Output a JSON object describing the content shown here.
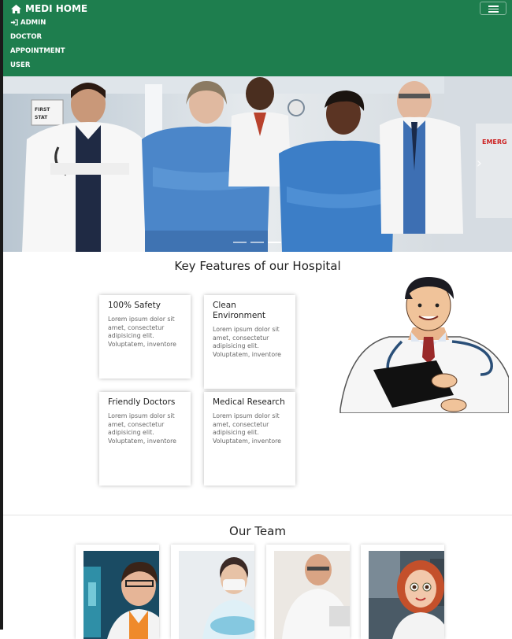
{
  "navbar": {
    "brand": "MEDI HOME",
    "links": [
      "ADMIN",
      "DOCTOR",
      "APPOINTMENT",
      "USER"
    ],
    "bg_color": "#1e7e4e"
  },
  "hero": {
    "image": "hospital-staff-group-photo",
    "sign_text_left": "FIRST STAT",
    "sign_text_right": "EMERG",
    "indicators": 3,
    "active_indicator": 2
  },
  "features": {
    "title": "Key Features of our Hospital",
    "cards": [
      {
        "title": "100% Safety",
        "text": "Lorem ipsum dolor sit amet, consectetur adipisicing elit. Voluptatem, inventore"
      },
      {
        "title": "Clean Environment",
        "text": "Lorem ipsum dolor sit amet, consectetur adipisicing elit. Voluptatem, inventore"
      },
      {
        "title": "Friendly Doctors",
        "text": "Lorem ipsum dolor sit amet, consectetur adipisicing elit. Voluptatem, inventore"
      },
      {
        "title": "Medical Research",
        "text": "Lorem ipsum dolor sit amet, consectetur adipisicing elit. Voluptatem, inventore"
      }
    ],
    "illustration": "cartoon-doctor-with-clipboard"
  },
  "team": {
    "title": "Our Team",
    "members": [
      "female-doctor-lab",
      "surgeon-mask",
      "senior-doctor",
      "cartoon-nurse"
    ]
  }
}
